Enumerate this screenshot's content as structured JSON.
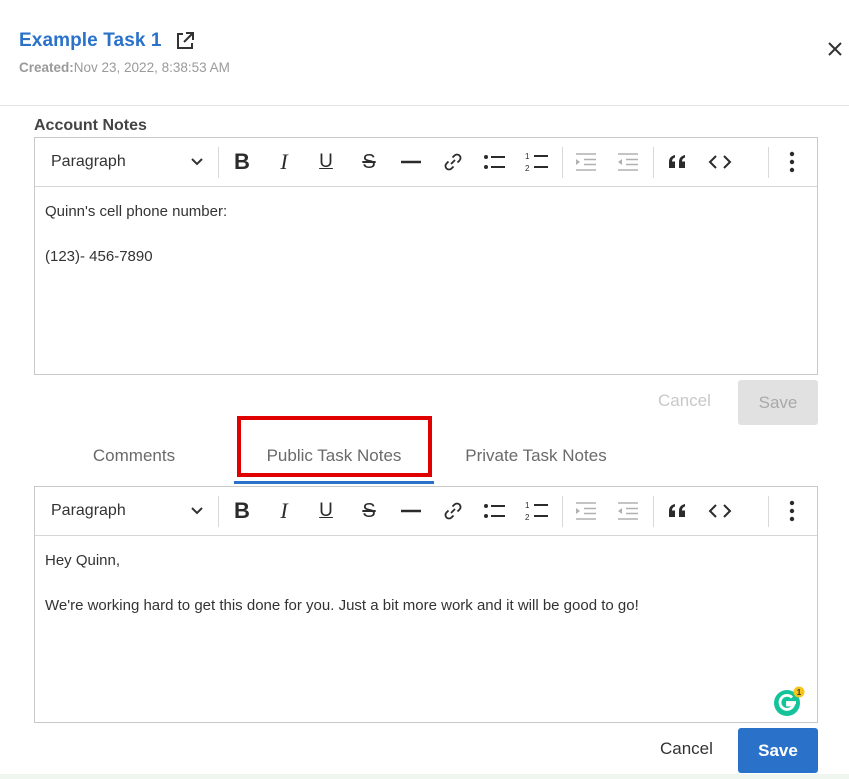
{
  "header": {
    "title": "Example Task 1",
    "created_label": "Created:",
    "created_value": "Nov 23, 2022, 8:38:53 AM"
  },
  "account_notes": {
    "label": "Account Notes",
    "format_value": "Paragraph",
    "lines": [
      "Quinn's cell phone number:",
      "(123)- 456-7890"
    ],
    "cancel_label": "Cancel",
    "save_label": "Save"
  },
  "tabs": [
    {
      "label": "Comments"
    },
    {
      "label": "Public Task Notes",
      "active": true
    },
    {
      "label": "Private Task Notes"
    }
  ],
  "task_notes": {
    "format_value": "Paragraph",
    "lines": [
      "Hey Quinn,",
      "We're working hard to get this done for you. Just a bit more work and it will be good to go!"
    ],
    "cancel_label": "Cancel",
    "save_label": "Save"
  },
  "grammarly": {
    "badge_count": "1"
  },
  "icons": {
    "external_link": "external-link-icon",
    "close": "close-icon",
    "bold": "bold-icon",
    "italic": "italic-icon",
    "underline": "underline-icon",
    "strikethrough": "strikethrough-icon",
    "horizontal_line": "horizontal-line-icon",
    "link": "link-icon",
    "bulleted_list": "bulleted-list-icon",
    "numbered_list": "numbered-list-icon",
    "indent": "indent-icon",
    "outdent": "outdent-icon",
    "blockquote": "blockquote-icon",
    "code": "code-icon",
    "more": "more-vertical-icon"
  },
  "colors": {
    "accent": "#2a72c9",
    "highlight": "#e00000",
    "grammarly": "#15c39a",
    "badge": "#f5c518"
  }
}
